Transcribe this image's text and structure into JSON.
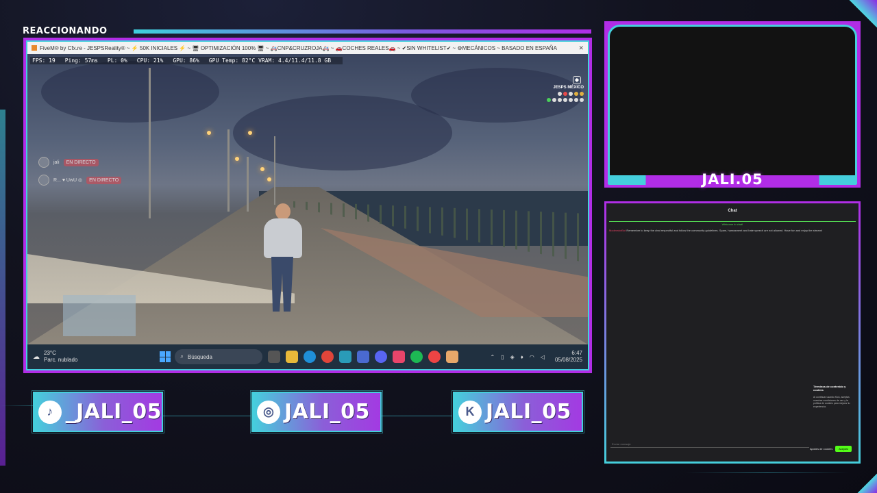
{
  "overlay": {
    "reacting_label": "REACCIONANDO",
    "cam_name": "JALI.05"
  },
  "game_window": {
    "title": "FiveM® by Cfx.re - JESPSReality® ~ ⚡ 50K INICIALES ⚡ ~ 🖥 OPTIMIZACIÓN 100% 🖥 ~ 🚑CNP&CRUZROJA🚑 ~ 🚗COCHES REALES🚗 ~ ✔SIN WHITELIST✔ ~ ⚙MECÁNICOS ~ BASADO EN ESPAÑA",
    "close_glyph": "✕",
    "perf": {
      "fps": "FPS: 19",
      "ping": "Ping: 57ms",
      "pl": "PL: 0%",
      "cpu": "CPU: 21%",
      "gpu": "GPU: 86%",
      "gpu_temp": "GPU Temp: 82°C  VRAM: 4.4/11.4/11.8 GB"
    },
    "hud": {
      "server": "JESPS MÉXICO"
    },
    "live_rows": [
      {
        "name": "jali",
        "badge": "EN DIRECTO"
      },
      {
        "name": "R...  ♥ UwU  ◎",
        "badge": "EN DIRECTO"
      }
    ]
  },
  "taskbar": {
    "temperature": "23°C",
    "weather": "Parc. nublado",
    "search_placeholder": "Búsqueda",
    "time": "6:47",
    "date": "05/08/2025"
  },
  "chat": {
    "title": "Chat",
    "welcome": "Welcome to chat!",
    "message_author": "ModeratorBot",
    "message_text": "Remember to keep the chat respectful and follow the community guidelines. Spam, harassment and hate speech are not allowed. Have fun and enjoy the stream!",
    "popup_title": "Términos de contenido y cookies",
    "popup_text": "Al continuar usando Kick, aceptas nuestras condiciones de uso y la política de cookies para mejorar tu experiencia.",
    "input_placeholder": "Enviar mensaje",
    "dismiss": "Ajustes de cookies",
    "accept": "Aceptar"
  },
  "socials": [
    {
      "platform": "tiktok",
      "glyph": "♪",
      "handle": "_JALI_05"
    },
    {
      "platform": "instagram",
      "glyph": "◎",
      "handle": "JALI_05"
    },
    {
      "platform": "kick",
      "glyph": "K",
      "handle": "JALI_05"
    }
  ],
  "colors": {
    "accent_purple": "#b12de6",
    "accent_cyan": "#45cfdc",
    "kick_green": "#53fc18"
  }
}
